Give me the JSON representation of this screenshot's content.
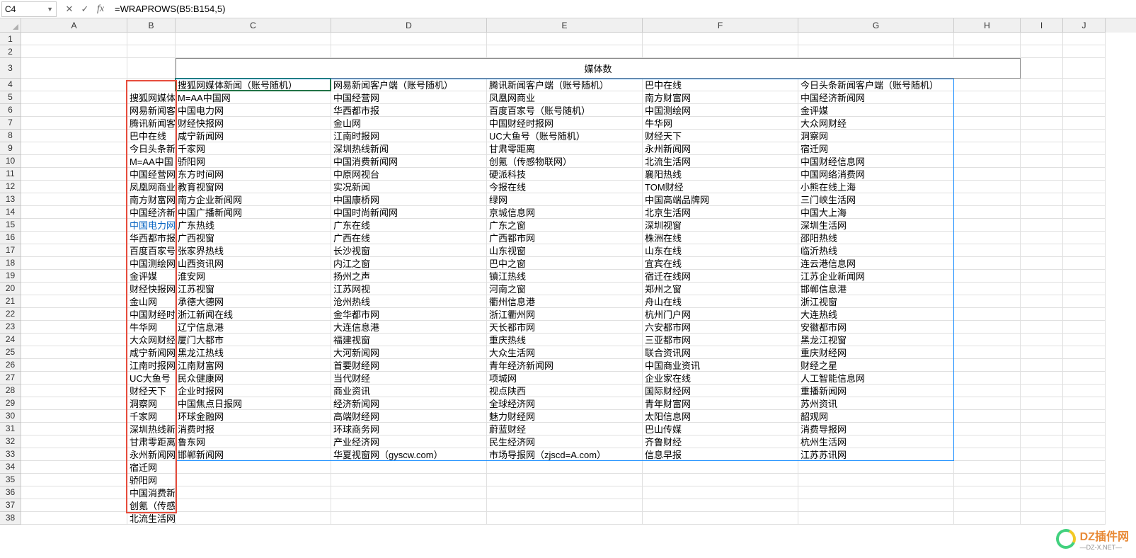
{
  "nameBox": "C4",
  "formula": "=WRAPROWS(B5:B154,5)",
  "mergedHeader": "媒体数",
  "colWidths": {
    "A": 150,
    "B": 68,
    "C": 220,
    "D": 220,
    "E": 220,
    "F": 220,
    "G": 220,
    "H": 94,
    "I": 60,
    "J": 60
  },
  "columns": [
    "A",
    "B",
    "C",
    "D",
    "E",
    "F",
    "G",
    "H",
    "I",
    "J"
  ],
  "rows": [
    {
      "n": 1,
      "cells": {}
    },
    {
      "n": 2,
      "cells": {}
    },
    {
      "n": 3,
      "cells": {},
      "merge": true
    },
    {
      "n": 4,
      "cells": {
        "C": "搜狐网媒体新闻（账号随机）",
        "D": "网易新闻客户端（账号随机）",
        "E": "腾讯新闻客户端（账号随机）",
        "F": "巴中在线",
        "G": "今日头条新闻客户端（账号随机）"
      }
    },
    {
      "n": 5,
      "cells": {
        "B": "搜狐网媒体",
        "C": "M=AA中国网",
        "D": "中国经营网",
        "E": "凤凰网商业",
        "F": "南方财富网",
        "G": "中国经济新闻网"
      }
    },
    {
      "n": 6,
      "cells": {
        "B": "网易新闻客",
        "C": "中国电力网",
        "D": "华西都市报",
        "E": "百度百家号（账号随机）",
        "F": "中国测绘网",
        "G": "金评媒"
      }
    },
    {
      "n": 7,
      "cells": {
        "B": "腾讯新闻客",
        "C": "财经快报网",
        "D": "金山网",
        "E": "中国财经时报网",
        "F": "牛华网",
        "G": "大众网财经"
      }
    },
    {
      "n": 8,
      "cells": {
        "B": "巴中在线",
        "C": "咸宁新闻网",
        "D": "江南时报网",
        "E": "UC大鱼号（账号随机）",
        "F": "财经天下",
        "G": "洞察网"
      }
    },
    {
      "n": 9,
      "cells": {
        "B": "今日头条新",
        "C": "千家网",
        "D": "深圳热线新闻",
        "E": "甘肃零距离",
        "F": "永州新闻网",
        "G": "宿迁网"
      }
    },
    {
      "n": 10,
      "cells": {
        "B": "M=AA中国",
        "C": "骄阳网",
        "D": "中国消费新闻网",
        "E": "创氪（传感物联网）",
        "F": "北流生活网",
        "G": "中国财经信息网"
      }
    },
    {
      "n": 11,
      "cells": {
        "B": "中国经营网",
        "C": "东方时间网",
        "D": "中原网视台",
        "E": "硬派科技",
        "F": "襄阳热线",
        "G": "中国网络消费网"
      }
    },
    {
      "n": 12,
      "cells": {
        "B": "凤凰网商业",
        "C": "教育视窗网",
        "D": "实况新闻",
        "E": "今报在线",
        "F": "TOM财经",
        "G": "小熊在线上海"
      }
    },
    {
      "n": 13,
      "cells": {
        "B": "南方财富网",
        "C": "南方企业新闻网",
        "D": "中国康桥网",
        "E": "绿网",
        "F": "中国高端品牌网",
        "G": "三门峡生活网"
      }
    },
    {
      "n": 14,
      "cells": {
        "B": "中国经济新",
        "C": "中国广播新闻网",
        "D": "中国时尚新闻网",
        "E": "京城信息网",
        "F": "北京生活网",
        "G": "中国大上海"
      }
    },
    {
      "n": 15,
      "cells": {
        "B": "中国电力网",
        "C": "广东热线",
        "D": "广东在线",
        "E": "广东之窗",
        "F": "深圳视窗",
        "G": "深圳生活网"
      },
      "link": "B"
    },
    {
      "n": 16,
      "cells": {
        "B": "华西都市报",
        "C": "广西视窗",
        "D": "广西在线",
        "E": "广西都市网",
        "F": "株洲在线",
        "G": "邵阳热线"
      }
    },
    {
      "n": 17,
      "cells": {
        "B": "百度百家号",
        "C": "张家界热线",
        "D": "长沙视窗",
        "E": "山东视窗",
        "F": "山东在线",
        "G": "临沂热线"
      }
    },
    {
      "n": 18,
      "cells": {
        "B": "中国测绘网",
        "C": "山西资讯网",
        "D": "内江之窗",
        "E": "巴中之窗",
        "F": "宜宾在线",
        "G": "连云港信息网"
      }
    },
    {
      "n": 19,
      "cells": {
        "B": "金评媒",
        "C": "淮安网",
        "D": "扬州之声",
        "E": "镇江热线",
        "F": "宿迁在线网",
        "G": "江苏企业新闻网"
      }
    },
    {
      "n": 20,
      "cells": {
        "B": "财经快报网",
        "C": "江苏视窗",
        "D": "江苏网视",
        "E": "河南之窗",
        "F": "郑州之窗",
        "G": "邯郸信息港"
      }
    },
    {
      "n": 21,
      "cells": {
        "B": "金山网",
        "C": "承德大德网",
        "D": "沧州热线",
        "E": "衢州信息港",
        "F": "舟山在线",
        "G": "浙江视窗"
      }
    },
    {
      "n": 22,
      "cells": {
        "B": "中国财经时",
        "C": "浙江新闻在线",
        "D": "金华都市网",
        "E": "浙江衢州网",
        "F": "杭州门户网",
        "G": "大连热线"
      }
    },
    {
      "n": 23,
      "cells": {
        "B": "牛华网",
        "C": "辽宁信息港",
        "D": "大连信息港",
        "E": "天长都市网",
        "F": "六安都市网",
        "G": "安徽都市网"
      }
    },
    {
      "n": 24,
      "cells": {
        "B": "大众网财经",
        "C": "厦门大都市",
        "D": "福建视窗",
        "E": "重庆热线",
        "F": "三亚都市网",
        "G": "黑龙江视窗"
      }
    },
    {
      "n": 25,
      "cells": {
        "B": "咸宁新闻网",
        "C": "黑龙江热线",
        "D": "大河新闻网",
        "E": "大众生活网",
        "F": "联合资讯网",
        "G": "重庆财经网"
      }
    },
    {
      "n": 26,
      "cells": {
        "B": "江南时报网",
        "C": "江南财富网",
        "D": "首要财经网",
        "E": "青年经济新闻网",
        "F": "中国商业资讯",
        "G": "财经之星"
      }
    },
    {
      "n": 27,
      "cells": {
        "B": "UC大鱼号",
        "C": "民众健康网",
        "D": "当代财经",
        "E": "项城网",
        "F": "企业家在线",
        "G": "人工智能信息网"
      }
    },
    {
      "n": 28,
      "cells": {
        "B": "财经天下",
        "C": "企业时报网",
        "D": "商业资讯",
        "E": "视点陕西",
        "F": "国际财经网",
        "G": "重播新闻网"
      }
    },
    {
      "n": 29,
      "cells": {
        "B": "洞察网",
        "C": "中国焦点日报网",
        "D": "经济新闻网",
        "E": "全球经济网",
        "F": "青年财富网",
        "G": "苏州资讯"
      }
    },
    {
      "n": 30,
      "cells": {
        "B": "千家网",
        "C": "环球金融网",
        "D": "高端财经网",
        "E": "魅力财经网",
        "F": "太阳信息网",
        "G": "韶观网"
      }
    },
    {
      "n": 31,
      "cells": {
        "B": "深圳热线新",
        "C": "消费时报",
        "D": "环球商务网",
        "E": "蔚蓝财经",
        "F": "巴山传媒",
        "G": "消费导报网"
      }
    },
    {
      "n": 32,
      "cells": {
        "B": "甘肃零距离",
        "C": "鲁东网",
        "D": "产业经济网",
        "E": "民生经济网",
        "F": "齐鲁财经",
        "G": "杭州生活网"
      }
    },
    {
      "n": 33,
      "cells": {
        "B": "永州新闻网",
        "C": "邯郸新闻网",
        "D": "华夏视窗网（gyscw.com）",
        "E": "市场导报网（zjscd=A.com）",
        "F": "信息早报",
        "G": "江苏苏讯网"
      }
    },
    {
      "n": 34,
      "cells": {
        "B": "宿迁网"
      }
    },
    {
      "n": 35,
      "cells": {
        "B": "骄阳网"
      }
    },
    {
      "n": 36,
      "cells": {
        "B": "中国消费新闻网"
      }
    },
    {
      "n": 37,
      "cells": {
        "B": "创氪（传感物联网）"
      }
    },
    {
      "n": 38,
      "cells": {
        "B": "北流生活网"
      }
    }
  ],
  "watermark": {
    "main": "DZ插件网",
    "sub": "—DZ-X.NET—"
  }
}
